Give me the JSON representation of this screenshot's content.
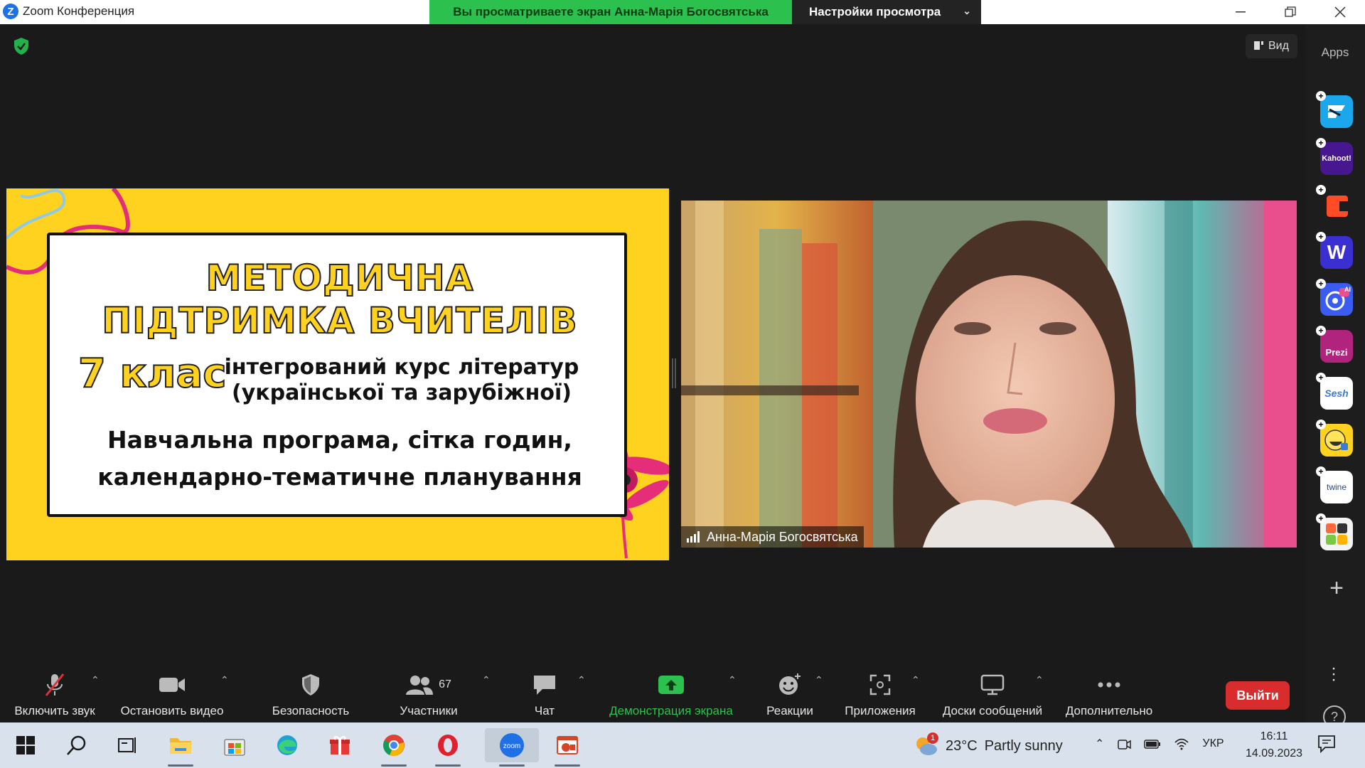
{
  "titlebar": {
    "app_title": "Zoom Конференция",
    "share_banner": "Вы просматриваете экран Анна-Марія Богосвятська",
    "view_options": "Настройки просмотра"
  },
  "main": {
    "view_button": "Вид",
    "apps_panel_title": "Apps",
    "apps": [
      {
        "name": "Flip",
        "label": "",
        "color": "#1aa7ec"
      },
      {
        "name": "Kahoot!",
        "label": "Kahoot!",
        "color": "#46178f"
      },
      {
        "name": "Class app",
        "label": "",
        "color": "#ff4b26"
      },
      {
        "name": "Wooclap",
        "label": "W",
        "color": "#3a2fd1"
      },
      {
        "name": "AI app",
        "label": "AI",
        "color": "#3b5cf0"
      },
      {
        "name": "Prezi",
        "label": "Prezi",
        "color": "#b0247e"
      },
      {
        "name": "Sesh",
        "label": "Sesh",
        "color": "#ffffff"
      },
      {
        "name": "Heads Up",
        "label": "",
        "color": "#ffd21f"
      },
      {
        "name": "Twine",
        "label": "twine",
        "color": "#ffffff"
      },
      {
        "name": "Games",
        "label": "",
        "color": "#f4f4f4"
      }
    ]
  },
  "slide": {
    "title_line1": "МЕТОДИЧНА",
    "title_line2": "ПІДТРИМКА ВЧИТЕЛІВ",
    "grade": "7 клас",
    "course_line1": "інтегрований курс літератур",
    "course_line2": "(української та зарубіжної)",
    "subtitle_line1": "Навчальна програма, сітка годин,",
    "subtitle_line2": "календарно-тематичне планування"
  },
  "video": {
    "participant_name": "Анна-Марія Богосвятська"
  },
  "toolbar": {
    "unmute": "Включить звук",
    "stop_video": "Остановить видео",
    "security": "Безопасность",
    "participants": "Участники",
    "participants_count": "67",
    "chat": "Чат",
    "share_screen": "Демонстрация экрана",
    "reactions": "Реакции",
    "apps": "Приложения",
    "whiteboards": "Доски сообщений",
    "more": "Дополнительно",
    "leave": "Выйти"
  },
  "taskbar": {
    "weather_temp": "23°C",
    "weather_text": "Partly sunny",
    "weather_badge": "1",
    "language": "УКР",
    "time": "16:11",
    "date": "14.09.2023"
  },
  "colors": {
    "zoom_blue": "#1f6fe5",
    "share_green": "#2cc14e",
    "leave_red": "#d92c2c",
    "slide_yellow": "#ffd21f"
  }
}
